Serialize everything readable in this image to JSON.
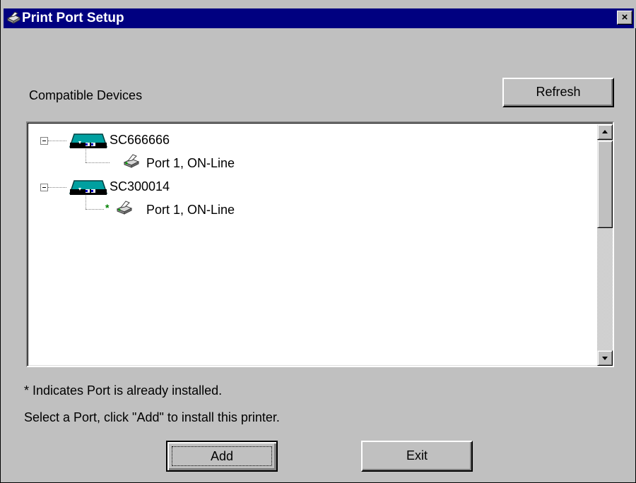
{
  "window": {
    "title": "Print Port Setup",
    "close_glyph": "×",
    "title_icon": "printer-icon"
  },
  "header": {
    "compatible_devices_label": "Compatible Devices",
    "refresh_label": "Refresh"
  },
  "tree": {
    "devices": [
      {
        "name": "SC666666",
        "icon": "print-server-icon",
        "expanded": true,
        "ports": [
          {
            "label": "Port 1, ON-Line",
            "installed": false,
            "icon": "printer-icon"
          }
        ]
      },
      {
        "name": "SC300014",
        "icon": "print-server-icon",
        "expanded": true,
        "ports": [
          {
            "label": "Port 1, ON-Line",
            "installed": true,
            "installed_marker": "*",
            "icon": "printer-icon"
          }
        ]
      }
    ]
  },
  "footer": {
    "note": "* Indicates Port is already installed.",
    "instruction": "Select a Port, click \"Add\" to install this printer.",
    "add_label": "Add",
    "exit_label": "Exit"
  },
  "colors": {
    "titlebar": "#000080",
    "face": "#c0c0c0",
    "installed_marker": "#008000"
  }
}
